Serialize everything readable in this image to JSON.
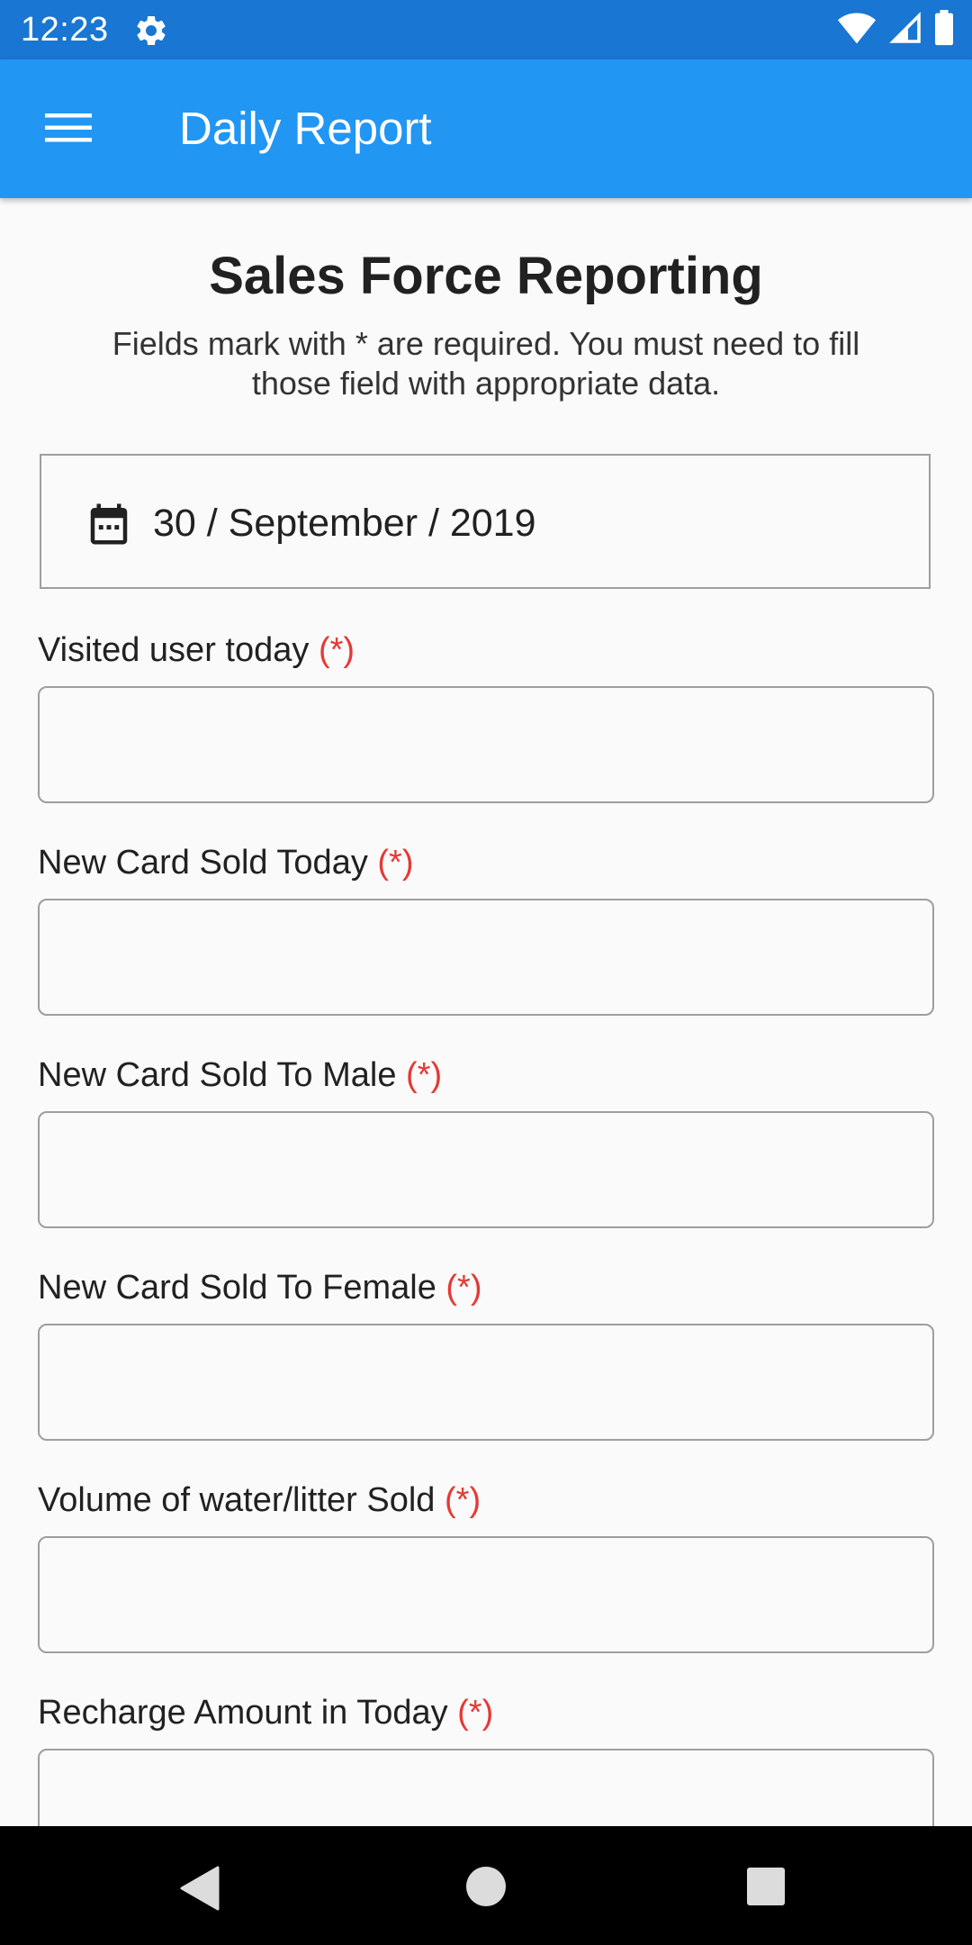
{
  "status_bar": {
    "time": "12:23",
    "icons": [
      "settings-gear-icon",
      "wifi-icon",
      "cell-signal-icon",
      "battery-icon"
    ]
  },
  "app_bar": {
    "title": "Daily Report",
    "menu_icon": "hamburger-menu-icon"
  },
  "form": {
    "heading": "Sales Force Reporting",
    "subheading": "Fields mark with * are required. You must need to fill those field with appropriate data.",
    "date": {
      "icon": "calendar-icon",
      "value": "30 / September / 2019"
    },
    "required_marker": "(*)",
    "fields": [
      {
        "label": "Visited user today",
        "value": "",
        "placeholder": ""
      },
      {
        "label": "New Card Sold Today",
        "value": "",
        "placeholder": ""
      },
      {
        "label": "New Card Sold To Male",
        "value": "",
        "placeholder": ""
      },
      {
        "label": "New Card Sold To Female",
        "value": "",
        "placeholder": ""
      },
      {
        "label": "Volume of water/litter Sold",
        "value": "",
        "placeholder": ""
      },
      {
        "label": "Recharge Amount in Today",
        "value": "",
        "placeholder": ""
      }
    ]
  },
  "nav_bar": {
    "buttons": [
      "back-triangle-icon",
      "home-circle-icon",
      "recents-square-icon"
    ]
  },
  "colors": {
    "status_bar": "#1976d2",
    "app_bar": "#2196f3",
    "required": "#e53935",
    "background": "#fafafa"
  }
}
